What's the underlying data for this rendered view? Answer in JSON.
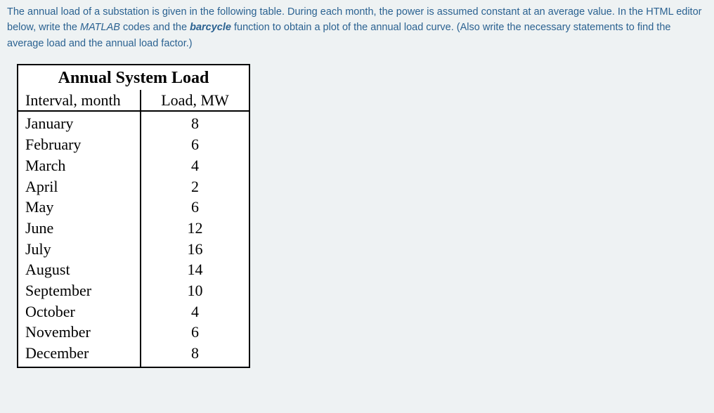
{
  "question": {
    "part1": "The annual load of a substation is given in the following table. During each month, the power is assumed constant at an average value. In the HTML editor below, write the ",
    "matlab": "MATLAB",
    "part2": " codes and the ",
    "barcycle": "barcycle",
    "part3": " function to obtain a plot of the annual load curve. (Also write the necessary statements to find the average load and the annual load factor.)"
  },
  "table": {
    "title": "Annual System Load",
    "headers": {
      "month": "Interval, month",
      "load": "Load, MW"
    },
    "rows": [
      {
        "month": "January",
        "load": "8"
      },
      {
        "month": "February",
        "load": "6"
      },
      {
        "month": "March",
        "load": "4"
      },
      {
        "month": "April",
        "load": "2"
      },
      {
        "month": "May",
        "load": "6"
      },
      {
        "month": "June",
        "load": "12"
      },
      {
        "month": "July",
        "load": "16"
      },
      {
        "month": "August",
        "load": "14"
      },
      {
        "month": "September",
        "load": "10"
      },
      {
        "month": "October",
        "load": "4"
      },
      {
        "month": "November",
        "load": "6"
      },
      {
        "month": "December",
        "load": "8"
      }
    ]
  },
  "chart_data": {
    "type": "table",
    "title": "Annual System Load",
    "xlabel": "Interval, month",
    "ylabel": "Load, MW",
    "categories": [
      "January",
      "February",
      "March",
      "April",
      "May",
      "June",
      "July",
      "August",
      "September",
      "October",
      "November",
      "December"
    ],
    "values": [
      8,
      6,
      4,
      2,
      6,
      12,
      16,
      14,
      10,
      4,
      6,
      8
    ]
  }
}
